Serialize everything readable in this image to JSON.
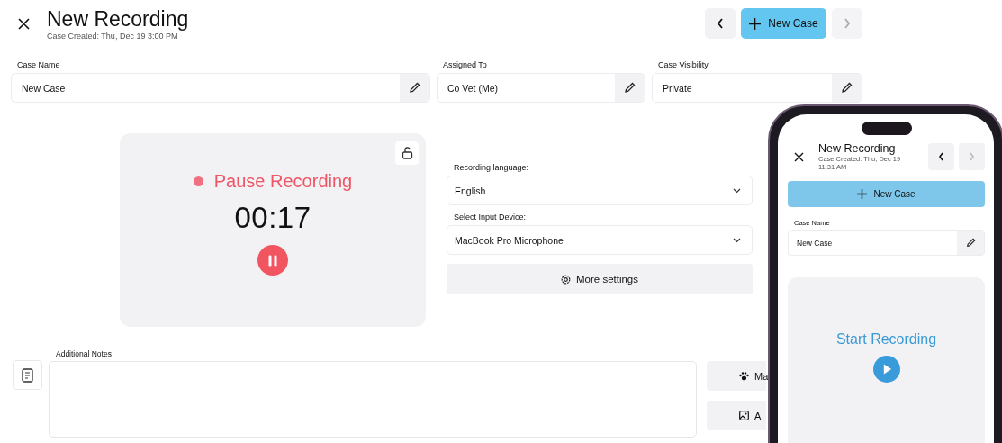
{
  "header": {
    "title": "New Recording",
    "subtitle": "Case Created: Thu, Dec 19 3:00 PM",
    "new_case_button": "New Case",
    "prev_disabled": false,
    "next_disabled": true
  },
  "fields": [
    {
      "label": "Case Name",
      "value": "New Case"
    },
    {
      "label": "Assigned To",
      "value": "Co Vet (Me)"
    },
    {
      "label": "Case Visibility",
      "value": "Private"
    }
  ],
  "recorder": {
    "status": "Pause Recording",
    "time": "00:17",
    "recording": true
  },
  "settings": [
    {
      "label": "Recording language:",
      "value": "English"
    },
    {
      "label": "Select Input Device:",
      "value": "MacBook Pro Microphone"
    }
  ],
  "more_settings_button": "More settings",
  "notes": {
    "label": "Additional Notes"
  },
  "side_buttons": [
    {
      "kind": "paw",
      "label": "Ma"
    },
    {
      "kind": "image",
      "label": "A"
    }
  ],
  "phone": {
    "title": "New Recording",
    "subtitle": "Case Created: Thu, Dec 19 11:31 AM",
    "new_case_button": "New Case",
    "prev_disabled": false,
    "next_disabled": true,
    "field": {
      "label": "Case Name",
      "value": "New Case"
    },
    "recorder": {
      "status": "Start Recording",
      "recording": false
    }
  }
}
